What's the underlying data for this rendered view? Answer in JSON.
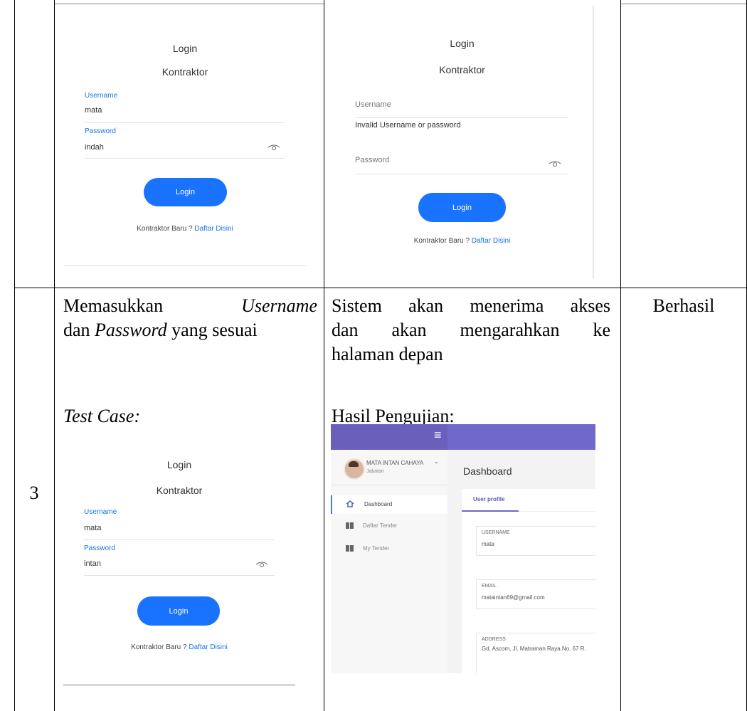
{
  "login_form_1": {
    "title": "Login",
    "subtitle": "Kontraktor",
    "username_label": "Username",
    "username_value": "mata",
    "password_label": "Password",
    "password_value": "indah",
    "button": "Login",
    "footer_text": "Kontraktor Baru ?",
    "footer_link": "Daftar Disini"
  },
  "login_result_1": {
    "title": "Login",
    "subtitle": "Kontraktor",
    "username_placeholder": "Username",
    "error": "Invalid Username or password",
    "password_placeholder": "Password",
    "button": "Login",
    "footer_text": "Kontraktor Baru ?",
    "footer_link": "Daftar Disini"
  },
  "row3": {
    "number": "3",
    "step_line1_a": "Memasukkan",
    "step_line1_b": "Username",
    "step_line2_a": "dan",
    "step_line2_b": "Password",
    "step_line2_c": "yang sesuai",
    "testcase_label": "Test Case:",
    "expected_line1": "Sistem akan menerima akses",
    "expected_line2": "dan akan mengarahkan ke",
    "expected_line3": "halaman depan",
    "result_label": "Hasil Pengujian:",
    "status": "Berhasil"
  },
  "login_form_2": {
    "title": "Login",
    "subtitle": "Kontraktor",
    "username_label": "Username",
    "username_value": "mata",
    "password_label": "Password",
    "password_value": "intan",
    "button": "Login",
    "footer_text": "Kontraktor Baru ?",
    "footer_link": "Daftar Disini"
  },
  "dashboard": {
    "menu_icon": "≡",
    "user_name": "MATA INTAN CAHAYA",
    "user_role": "Jabatan",
    "page_title": "Dashboard",
    "nav": [
      {
        "label": "Dashboard",
        "icon": "home-icon"
      },
      {
        "label": "Daftar Tender",
        "icon": "book-icon"
      },
      {
        "label": "My Tender",
        "icon": "book-icon"
      }
    ],
    "tab": "User profile",
    "fields": [
      {
        "label": "USERNAME",
        "value": "mata"
      },
      {
        "label": "EMAIL",
        "value": "mataintan69@gmail.com"
      },
      {
        "label": "ADDRESS",
        "value": "Gd. Ascom, Jl. Matraman Raya No. 67 R."
      }
    ],
    "colors": {
      "header": "#6f68c8",
      "sidebar_header": "#6a60bc",
      "accent": "#6f68c8"
    }
  }
}
